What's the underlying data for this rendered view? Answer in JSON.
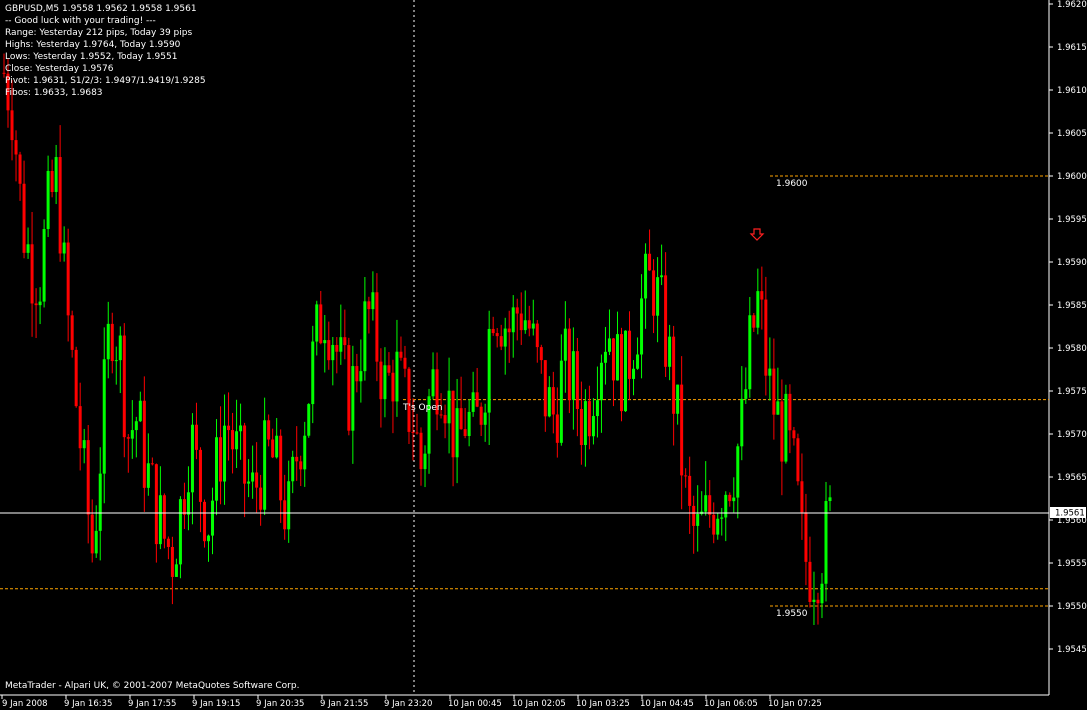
{
  "header": {
    "symbol_line": "GBPUSD,M5  1.9558 1.9562 1.9558 1.9561",
    "info_lines": [
      "-- Good luck with your trading! ---",
      "Range: Yesterday 212 pips, Today 39 pips",
      "Highs: Yesterday 1.9764, Today 1.9590",
      "Lows:  Yesterday 1.9552, Today 1.9551",
      "Close: Yesterday 1.9576",
      "Pivot: 1.9631, S1/2/3: 1.9497/1.9419/1.9285",
      "Fibos: 1.9633, 1.9683"
    ]
  },
  "footer": {
    "copyright": "MetaTrader - Alpari UK, © 2001-2007 MetaQuotes Software Corp."
  },
  "colors": {
    "background": "#000000",
    "bull": "#00ff00",
    "bear": "#ff0000",
    "level_line": "#ffa500",
    "axis": "#ffffff"
  },
  "annotations": {
    "todays_open_label": "T's Open",
    "level_1_9600": "1.9600",
    "level_1_9550": "1.9550",
    "sell_arrow_icon": "down-arrow-icon"
  },
  "chart_data": {
    "type": "candlestick",
    "symbol": "GBPUSD",
    "timeframe": "M5",
    "ylim": [
      1.9545,
      1.962
    ],
    "y_ticks": [
      "1.9620",
      "1.9615",
      "1.9610",
      "1.9605",
      "1.9600",
      "1.9595",
      "1.9590",
      "1.9585",
      "1.9580",
      "1.9575",
      "1.9570",
      "1.9565",
      "1.9560",
      "1.9555",
      "1.9550",
      "1.9545"
    ],
    "x_ticks": [
      "9 Jan 2008",
      "9 Jan 16:35",
      "9 Jan 17:55",
      "9 Jan 19:15",
      "9 Jan 20:35",
      "9 Jan 21:55",
      "9 Jan 23:20",
      "10 Jan 00:45",
      "10 Jan 02:05",
      "10 Jan 03:25",
      "10 Jan 04:45",
      "10 Jan 06:05",
      "10 Jan 07:25"
    ],
    "current_price": "1.9561",
    "levels": [
      {
        "price": 1.96
      },
      {
        "price": 1.9574
      },
      {
        "price": 1.9552
      },
      {
        "price": 1.955
      }
    ],
    "close_path": [
      1.9612,
      1.9608,
      1.9595,
      1.959,
      1.9588,
      1.9596,
      1.96,
      1.9585,
      1.9575,
      1.9565,
      1.9556,
      1.957,
      1.9584,
      1.958,
      1.957,
      1.9572,
      1.9566,
      1.9562,
      1.9558,
      1.9556,
      1.9562,
      1.957,
      1.9564,
      1.956,
      1.9566,
      1.9572,
      1.9568,
      1.9565,
      1.9563,
      1.9566,
      1.9568,
      1.9564,
      1.956,
      1.9568,
      1.9573,
      1.958,
      1.9585,
      1.9582,
      1.9577,
      1.9574,
      1.958,
      1.9584,
      1.958,
      1.9575,
      1.9578,
      1.9574,
      1.9572,
      1.9566,
      1.9575,
      1.9578,
      1.9574,
      1.9568,
      1.9572,
      1.957,
      1.9575,
      1.9586,
      1.9584,
      1.9582,
      1.9585,
      1.9583,
      1.9578,
      1.9574,
      1.9572,
      1.9578,
      1.9576,
      1.9572,
      1.9574,
      1.958,
      1.9583,
      1.9578,
      1.9577,
      1.9582,
      1.9586,
      1.9588,
      1.9584,
      1.9578,
      1.957,
      1.956,
      1.9558,
      1.956,
      1.9562,
      1.9564,
      1.9566,
      1.957,
      1.958,
      1.9586,
      1.9576,
      1.9572,
      1.957,
      1.9565,
      1.9556,
      1.9554,
      1.9556,
      1.956
    ]
  }
}
